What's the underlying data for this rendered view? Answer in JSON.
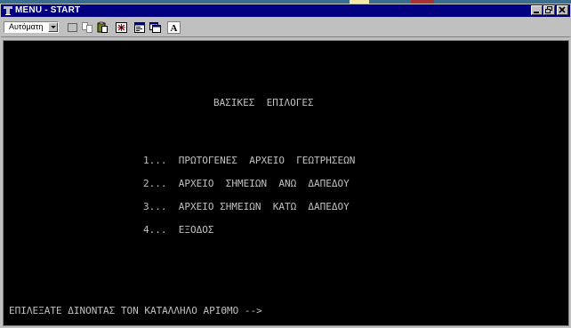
{
  "window": {
    "title": "MENU - START"
  },
  "toolbar": {
    "font_select_value": "Αυτόματη",
    "tools": [
      "mark-icon",
      "copy-icon",
      "paste-icon",
      "fullscreen-icon",
      "properties-icon",
      "background-icon",
      "font-icon"
    ]
  },
  "console": {
    "heading": "ΒΑΣΙΚΕΣ  ΕΠΙΛΟΓΕΣ",
    "options": [
      "1...  ΠΡΩΤΟΓΕΝΕΣ  ΑΡΧΕΙΟ  ΓΕΩΤΡΗΣΕΩΝ",
      "2...  ΑΡΧΕΙΟ  ΣΗΜΕΙΩΝ  ΑΝΩ  ΔΑΠΕΔΟΥ",
      "3...  ΑΡΧΕΙΟ ΣΗΜΕΙΩΝ  ΚΑΤΩ  ΔΑΠΕΔΟΥ",
      "4...  ΕΞΟΔΟΣ"
    ],
    "prompt": "ΕΠΙΛΕΞΑΤΕ ΔΙΝΟΝΤΑΣ ΤΟΝ ΚΑΤΑΛΛΗΛΟ ΑΡΙΘΜΟ -->"
  },
  "colors": {
    "titlebar": "#000080",
    "console_bg": "#000000",
    "console_text": "#c0c0c0",
    "chrome": "#c0c0c0"
  }
}
